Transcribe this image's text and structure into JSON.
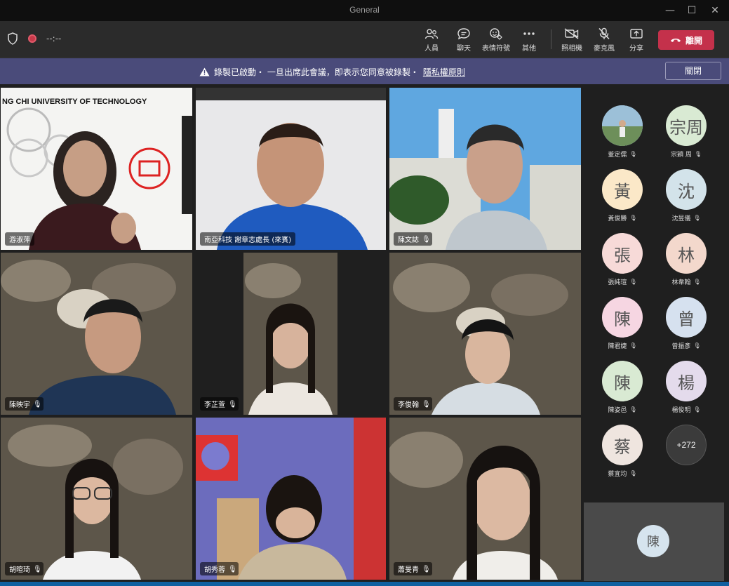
{
  "window": {
    "title": "General"
  },
  "toolbar": {
    "timer": "--:--",
    "buttons": [
      {
        "label": "人員",
        "icon": "people-icon"
      },
      {
        "label": "聊天",
        "icon": "chat-icon"
      },
      {
        "label": "表情符號",
        "icon": "reactions-icon"
      },
      {
        "label": "其他",
        "icon": "more-icon"
      },
      {
        "label": "照相機",
        "icon": "camera-off-icon"
      },
      {
        "label": "麥克風",
        "icon": "mic-off-icon"
      },
      {
        "label": "分享",
        "icon": "share-icon"
      }
    ],
    "leave_label": "離開"
  },
  "banner": {
    "text": "錄製已啟動・ 一旦出席此會議，即表示您同意被錄製・",
    "link": "隱私權原則",
    "dismiss": "關閉"
  },
  "tiles": [
    {
      "name": "游淑萍",
      "muted": false,
      "bg": "#f2f2f2"
    },
    {
      "name": "南亞科技 謝章志處長 (來賓)",
      "muted": false,
      "bg": "#3a3f48",
      "active": true
    },
    {
      "name": "陳文誌",
      "muted": true,
      "bg": "#7fb6e0"
    },
    {
      "name": "陳映宇",
      "muted": true,
      "bg": "#5a5548"
    },
    {
      "name": "李芷萱",
      "muted": true,
      "bg": "#5a5548"
    },
    {
      "name": "李俊翰",
      "muted": true,
      "bg": "#5a5548"
    },
    {
      "name": "胡暄琦",
      "muted": true,
      "bg": "#5a5548"
    },
    {
      "name": "胡秀蓉",
      "muted": true,
      "bg": "#6a6ab0"
    },
    {
      "name": "蕭旻青",
      "muted": true,
      "bg": "#5a5548"
    }
  ],
  "tile_banner_text": "NG CHI UNIVERSITY OF TECHNOLOGY",
  "roster": [
    {
      "name": "董定儒",
      "initial": "",
      "color": "#8fb0c8",
      "photo": true
    },
    {
      "name": "宗穎 周",
      "initial": "宗周",
      "color": "#d9ead3"
    },
    {
      "name": "黃俊勝",
      "initial": "黃",
      "color": "#fbe8c8"
    },
    {
      "name": "沈昱儀",
      "initial": "沈",
      "color": "#d3e3ea"
    },
    {
      "name": "張純瑄",
      "initial": "張",
      "color": "#f7dad8"
    },
    {
      "name": "林韋翰",
      "initial": "林",
      "color": "#f3d8cc"
    },
    {
      "name": "陳君婕",
      "initial": "陳",
      "color": "#f6d6e2"
    },
    {
      "name": "曾振彥",
      "initial": "曾",
      "color": "#d6e1ef"
    },
    {
      "name": "陳姿邑",
      "initial": "陳",
      "color": "#d9ead3"
    },
    {
      "name": "楊俊明",
      "initial": "楊",
      "color": "#e4dbec"
    },
    {
      "name": "蔡宜均",
      "initial": "蔡",
      "color": "#efe5df"
    },
    {
      "name": "",
      "initial": "+272",
      "color": "#3b3b3b",
      "more": true
    }
  ],
  "self_initial": "陳"
}
